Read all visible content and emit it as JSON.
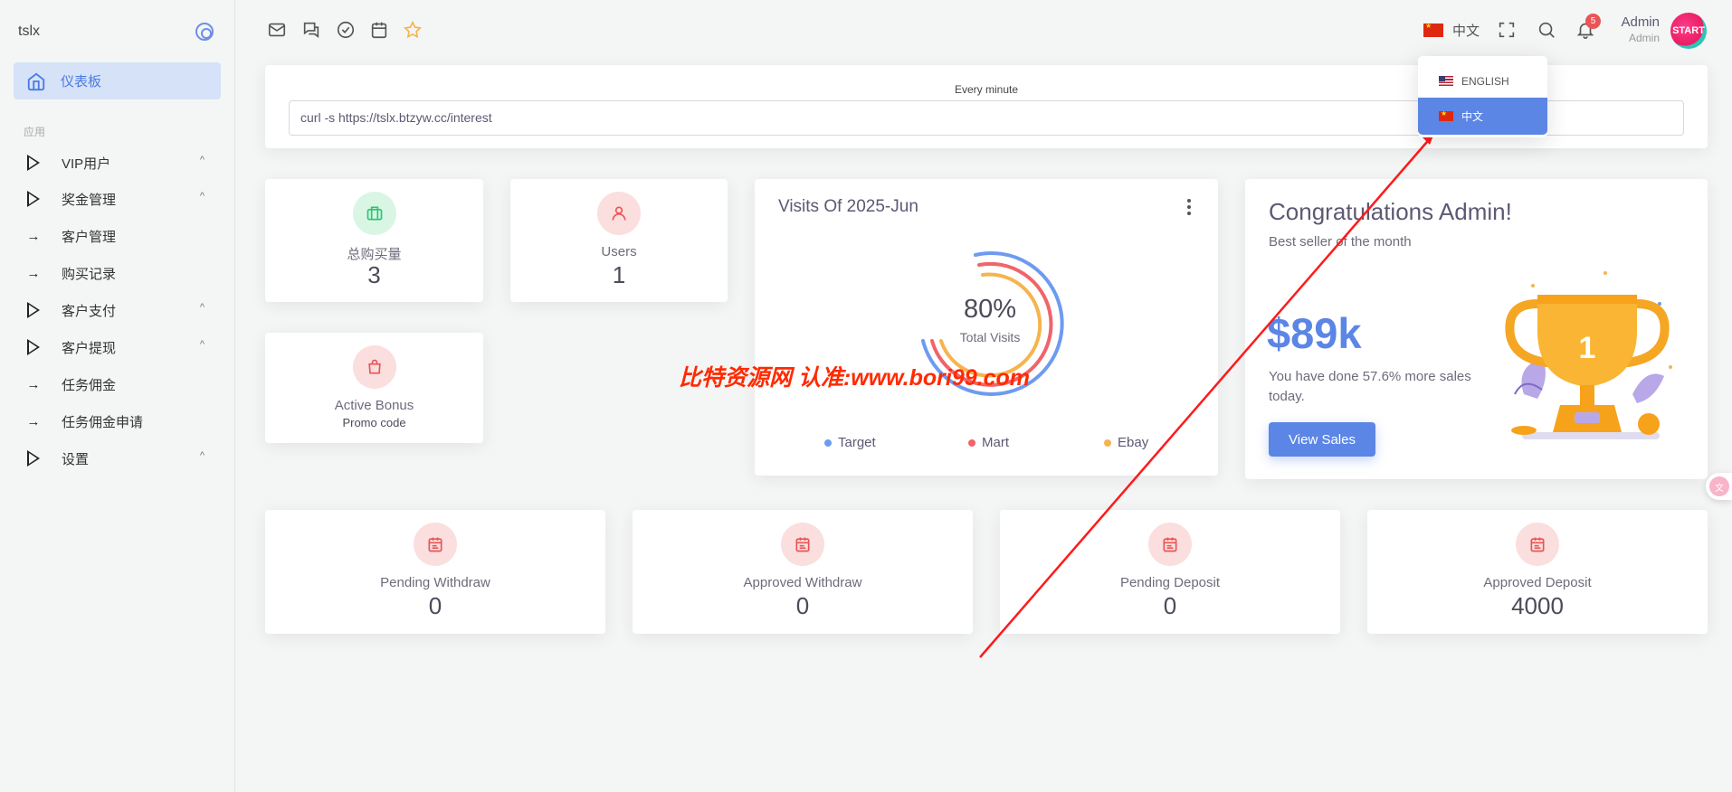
{
  "sidebar": {
    "brand": "tslx",
    "active_item": "仪表板",
    "section_label": "应用",
    "items": [
      {
        "label": "VIP用户",
        "icon": "triangle-right-icon",
        "expandable": true
      },
      {
        "label": "奖金管理",
        "icon": "triangle-right-icon",
        "expandable": true
      },
      {
        "label": "客户管理",
        "icon": "arrow-right-icon",
        "expandable": false
      },
      {
        "label": "购买记录",
        "icon": "arrow-right-icon",
        "expandable": false
      },
      {
        "label": "客户支付",
        "icon": "triangle-right-icon",
        "expandable": true
      },
      {
        "label": "客户提现",
        "icon": "triangle-right-icon",
        "expandable": true
      },
      {
        "label": "任务佣金",
        "icon": "arrow-right-icon",
        "expandable": false
      },
      {
        "label": "任务佣金申请",
        "icon": "arrow-right-icon",
        "expandable": false
      },
      {
        "label": "设置",
        "icon": "triangle-right-icon",
        "expandable": true
      }
    ]
  },
  "topbar": {
    "shortcuts": [
      "mail-icon",
      "chat-icon",
      "check-circle-icon",
      "calendar-icon",
      "star-icon"
    ],
    "language": "中文",
    "notification_count": "5",
    "user_name": "Admin",
    "user_role": "Admin",
    "avatar_text": "START"
  },
  "language_menu": {
    "options": [
      {
        "label": "ENGLISH",
        "flag": "us-flag-icon",
        "selected": false
      },
      {
        "label": "中文",
        "flag": "cn-flag-icon",
        "selected": true
      }
    ]
  },
  "cron": {
    "label": "Every minute",
    "command": "curl -s https://tslx.btzyw.cc/interest"
  },
  "stats": {
    "total_purchase": {
      "label": "总购买量",
      "value": "3",
      "icon": "briefcase-icon"
    },
    "users": {
      "label": "Users",
      "value": "1",
      "icon": "user-icon"
    },
    "active_bonus": {
      "label": "Active Bonus",
      "sublabel": "Promo code",
      "icon": "shopping-bag-icon"
    }
  },
  "visits": {
    "title": "Visits Of 2025-Jun",
    "center_value": "80%",
    "center_label": "Total Visits",
    "legend": [
      {
        "name": "Target",
        "color": "#6e9bef"
      },
      {
        "name": "Mart",
        "color": "#f0646a"
      },
      {
        "name": "Ebay",
        "color": "#f5b44f"
      }
    ]
  },
  "congrats": {
    "title": "Congratulations Admin!",
    "subtitle": "Best seller of the month",
    "amount": "$89k",
    "description": "You have done 57.6% more sales today.",
    "button": "View Sales",
    "trophy_number": "1"
  },
  "bottom_stats": [
    {
      "label": "Pending Withdraw",
      "value": "0",
      "icon": "calendar-icon"
    },
    {
      "label": "Approved Withdraw",
      "value": "0",
      "icon": "calendar-icon"
    },
    {
      "label": "Pending Deposit",
      "value": "0",
      "icon": "calendar-icon"
    },
    {
      "label": "Approved Deposit",
      "value": "4000",
      "icon": "calendar-icon"
    }
  ],
  "watermark": "比特资源网 认准:www.bori99.com",
  "colors": {
    "primary": "#5b86e5",
    "danger": "#ea5455",
    "success": "#28c76f",
    "warning": "#f5b44f"
  }
}
